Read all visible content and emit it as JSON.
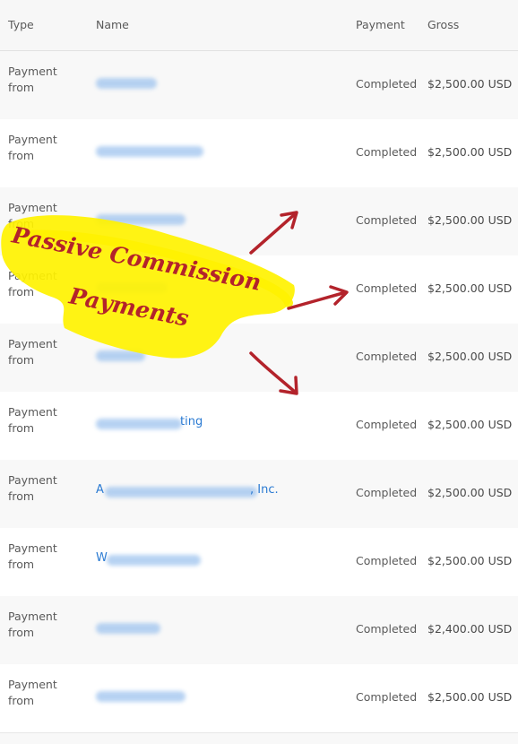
{
  "table": {
    "headers": {
      "type": "Type",
      "name": "Name",
      "payment": "Payment",
      "gross": "Gross"
    },
    "rows": [
      {
        "type": "Payment from",
        "name_prefix": "",
        "name_suffix": "",
        "status": "Completed",
        "gross": "$2,500.00 USD"
      },
      {
        "type": "Payment from",
        "name_prefix": "",
        "name_suffix": "",
        "status": "Completed",
        "gross": "$2,500.00 USD"
      },
      {
        "type": "Payment from",
        "name_prefix": "",
        "name_suffix": "",
        "status": "Completed",
        "gross": "$2,500.00 USD"
      },
      {
        "type": "Payment from",
        "name_prefix": "",
        "name_suffix": "",
        "status": "Completed",
        "gross": "$2,500.00 USD"
      },
      {
        "type": "Payment from",
        "name_prefix": "",
        "name_suffix": "",
        "status": "Completed",
        "gross": "$2,500.00 USD"
      },
      {
        "type": "Payment from",
        "name_prefix": "",
        "name_suffix": "ting",
        "status": "Completed",
        "gross": "$2,500.00 USD"
      },
      {
        "type": "Payment from",
        "name_prefix": "A",
        "name_suffix": ", Inc.",
        "status": "Completed",
        "gross": "$2,500.00 USD"
      },
      {
        "type": "Payment from",
        "name_prefix": "W",
        "name_suffix": "",
        "status": "Completed",
        "gross": "$2,500.00 USD"
      },
      {
        "type": "Payment from",
        "name_prefix": "",
        "name_suffix": "",
        "status": "Completed",
        "gross": "$2,400.00 USD"
      },
      {
        "type": "Payment from",
        "name_prefix": "",
        "name_suffix": "",
        "status": "Completed",
        "gross": "$2,500.00 USD"
      }
    ]
  },
  "annotation": {
    "line1": "Passive Commission",
    "line2": "Payments",
    "highlight_color": "#fff200",
    "ink_color": "#b3232b"
  }
}
